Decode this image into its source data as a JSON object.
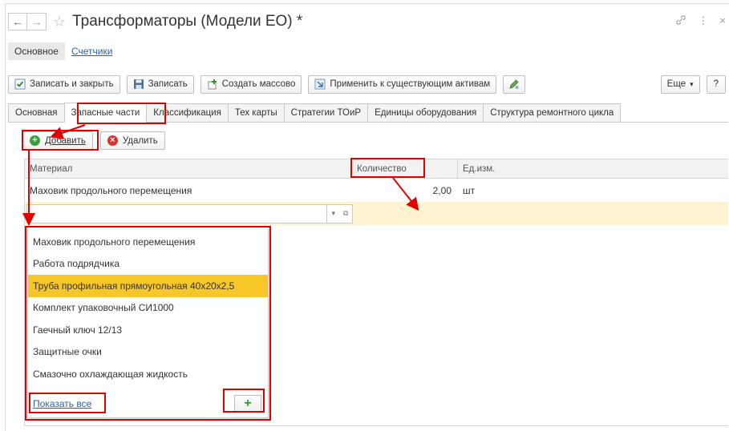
{
  "window": {
    "title": "Трансформаторы (Модели ЕО) *",
    "back_icon": "←",
    "forward_icon": "→",
    "star_icon": "☆",
    "link_icon": "🔗",
    "more_icon": "⋮",
    "close_icon": "×"
  },
  "sections": [
    {
      "label": "Основное"
    },
    {
      "label": "Счетчики"
    }
  ],
  "toolbar": {
    "save_close": "Записать и закрыть",
    "save": "Записать",
    "bulk_create": "Создать массово",
    "apply_assets": "Применить к существующим активам",
    "more": "Еще",
    "more_arrow": "▾",
    "help": "?"
  },
  "tabs": [
    {
      "label": "Основная"
    },
    {
      "label": "Запасные части"
    },
    {
      "label": "Классификация"
    },
    {
      "label": "Тех карты"
    },
    {
      "label": "Стратегии ТОиР"
    },
    {
      "label": "Единицы оборудования"
    },
    {
      "label": "Структура ремонтного цикла"
    }
  ],
  "subtoolbar": {
    "add": "Добавить",
    "delete": "Удалить"
  },
  "table": {
    "columns": [
      "Материал",
      "Количество",
      "Ед.изм."
    ],
    "rows": [
      {
        "material": "Маховик продольного перемещения",
        "quantity": "2,00",
        "unit": "шт"
      }
    ]
  },
  "dropdown": {
    "items": [
      {
        "label": "Маховик продольного перемещения",
        "selected": false
      },
      {
        "label": "Работа подрядчика",
        "selected": false
      },
      {
        "label": "Труба профильная прямоугольная 40х20х2,5",
        "selected": true
      },
      {
        "label": "Комплект упаковочный СИ1000",
        "selected": false
      },
      {
        "label": "Гаечный ключ 12/13",
        "selected": false
      },
      {
        "label": "Защитные очки",
        "selected": false
      },
      {
        "label": "Смазочно охлаждающая жидкость",
        "selected": false
      }
    ],
    "show_all": "Показать все",
    "add_icon": "+"
  },
  "colors": {
    "highlight": "#e00000",
    "selected_row": "#f7c629",
    "edit_row": "#fdf3d0",
    "link": "#2d5fa8"
  }
}
